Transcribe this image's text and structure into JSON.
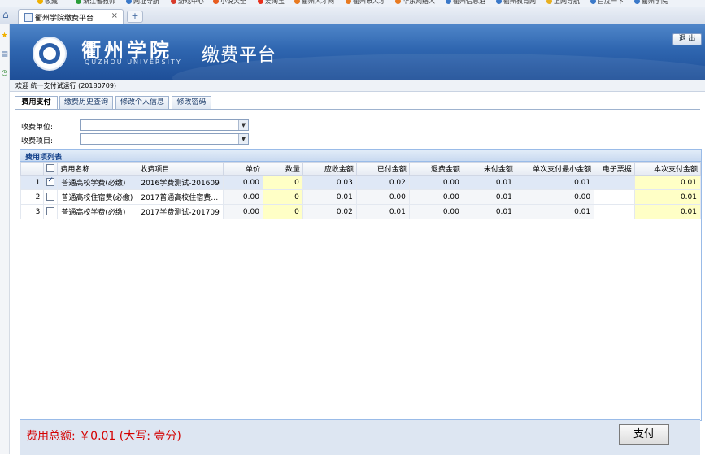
{
  "browser": {
    "bookmarks": [
      {
        "label": "收藏",
        "color": "#f0b000",
        "icon": "star-icon"
      },
      {
        "label": "浙江省教师",
        "color": "#2a9d3a",
        "icon": "site-icon"
      },
      {
        "label": "网址导航",
        "color": "#3b79c9",
        "icon": "site-icon"
      },
      {
        "label": "游戏中心",
        "color": "#d83a2a",
        "icon": "site-icon"
      },
      {
        "label": "小说大全",
        "color": "#e85d20",
        "icon": "site-icon"
      },
      {
        "label": "爱淘宝",
        "color": "#e8301c",
        "icon": "site-icon"
      },
      {
        "label": "衢州人才网",
        "color": "#e87a20",
        "icon": "site-icon"
      },
      {
        "label": "衢州市人才",
        "color": "#e87a20",
        "icon": "site-icon"
      },
      {
        "label": "华东网络人",
        "color": "#e87a20",
        "icon": "site-icon"
      },
      {
        "label": "衢州信息港",
        "color": "#3b79c9",
        "icon": "site-icon"
      },
      {
        "label": "衢州教育网",
        "color": "#3b79c9",
        "icon": "site-icon"
      },
      {
        "label": "上网导航",
        "color": "#e8b020",
        "icon": "site-icon"
      },
      {
        "label": "百度一下",
        "color": "#3b79c9",
        "icon": "site-icon"
      },
      {
        "label": "衢州学院",
        "color": "#3b79c9",
        "icon": "site-icon"
      }
    ],
    "tab_title": "衢州学院缴费平台",
    "tab_close": "×",
    "new_tab": "+"
  },
  "header": {
    "university_name": "衢州学院",
    "university_english": "QUZHOU UNIVERSITY",
    "platform_title": "缴费平台",
    "logout_label": "退 出"
  },
  "welcome": "欢迎 统一支付试运行 (20180709)",
  "tabs": [
    {
      "label": "费用支付",
      "active": true
    },
    {
      "label": "缴费历史查询",
      "active": false
    },
    {
      "label": "修改个人信息",
      "active": false
    },
    {
      "label": "修改密码",
      "active": false
    }
  ],
  "form": {
    "unit_label": "收费单位:",
    "unit_value": "",
    "item_label": "收费项目:",
    "item_value": ""
  },
  "grid": {
    "title": "费用项列表",
    "columns": [
      "",
      "",
      "费用名称",
      "收费项目",
      "单价",
      "数量",
      "应收金额",
      "已付金额",
      "退费金额",
      "未付金额",
      "单次支付最小金额",
      "电子票据",
      "本次支付金额"
    ],
    "rows": [
      {
        "index": "1",
        "checked": true,
        "name": "普通高校学费(必缴)",
        "item": "2016学费测试-201609",
        "unit_price": "0.00",
        "qty": "0",
        "receivable": "0.03",
        "paid": "0.02",
        "refund": "0.00",
        "unpaid": "0.01",
        "min_pay": "0.01",
        "e_receipt": "",
        "pay_now": "0.01",
        "selected": true
      },
      {
        "index": "2",
        "checked": false,
        "name": "普通高校住宿费(必缴)",
        "item": "2017普通高校住宿费…",
        "unit_price": "0.00",
        "qty": "0",
        "receivable": "0.01",
        "paid": "0.00",
        "refund": "0.00",
        "unpaid": "0.01",
        "min_pay": "0.00",
        "e_receipt": "",
        "pay_now": "0.01",
        "selected": false
      },
      {
        "index": "3",
        "checked": false,
        "name": "普通高校学费(必缴)",
        "item": "2017学费测试-201709",
        "unit_price": "0.00",
        "qty": "0",
        "receivable": "0.02",
        "paid": "0.01",
        "refund": "0.00",
        "unpaid": "0.01",
        "min_pay": "0.01",
        "e_receipt": "",
        "pay_now": "0.01",
        "selected": false
      }
    ]
  },
  "footer": {
    "total_label": "费用总额: ￥0.01 (大写: 壹分)",
    "pay_button": "支付"
  },
  "colors": {
    "banner": "#2f66b0",
    "total_text": "#d40000",
    "editable_cell": "#ffffc6",
    "selected_row": "#dfe8f6"
  }
}
